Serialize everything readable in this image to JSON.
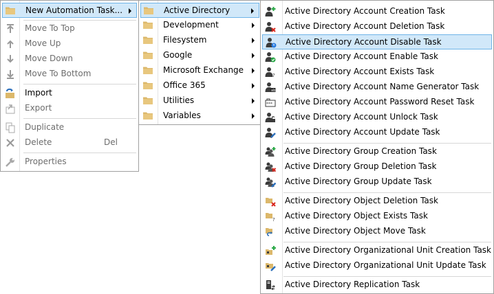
{
  "menu1": {
    "items": [
      {
        "label": "New Automation Task..."
      },
      {
        "label": "Move To Top"
      },
      {
        "label": "Move Up"
      },
      {
        "label": "Move Down"
      },
      {
        "label": "Move To Bottom"
      },
      {
        "label": "Import"
      },
      {
        "label": "Export"
      },
      {
        "label": "Duplicate"
      },
      {
        "label": "Delete",
        "shortcut": "Del"
      },
      {
        "label": "Properties"
      }
    ]
  },
  "menu2": {
    "items": [
      {
        "label": "Active Directory"
      },
      {
        "label": "Development"
      },
      {
        "label": "Filesystem"
      },
      {
        "label": "Google"
      },
      {
        "label": "Microsoft Exchange"
      },
      {
        "label": "Office 365"
      },
      {
        "label": "Utilities"
      },
      {
        "label": "Variables"
      }
    ]
  },
  "menu3": {
    "items": [
      {
        "label": "Active Directory Account Creation Task"
      },
      {
        "label": "Active Directory Account Deletion Task"
      },
      {
        "label": "Active Directory Account Disable Task"
      },
      {
        "label": "Active Directory Account Enable Task"
      },
      {
        "label": "Active Directory Account Exists Task"
      },
      {
        "label": "Active Directory Account Name Generator Task"
      },
      {
        "label": "Active Directory Account Password Reset Task"
      },
      {
        "label": "Active Directory Account Unlock Task"
      },
      {
        "label": "Active Directory Account Update Task"
      },
      {
        "label": "Active Directory Group Creation Task"
      },
      {
        "label": "Active Directory Group Deletion Task"
      },
      {
        "label": "Active Directory Group Update Task"
      },
      {
        "label": "Active Directory Object Deletion Task"
      },
      {
        "label": "Active Directory Object Exists Task"
      },
      {
        "label": "Active Directory Object Move Task"
      },
      {
        "label": "Active Directory Organizational Unit Creation Task"
      },
      {
        "label": "Active Directory Organizational Unit Update Task"
      },
      {
        "label": "Active Directory Replication Task"
      }
    ]
  },
  "colors": {
    "highlight_bg": "#d1e8f9",
    "highlight_border": "#6eb4e8",
    "folder": "#dcb86b",
    "disabled_text": "#6d6d6d"
  }
}
